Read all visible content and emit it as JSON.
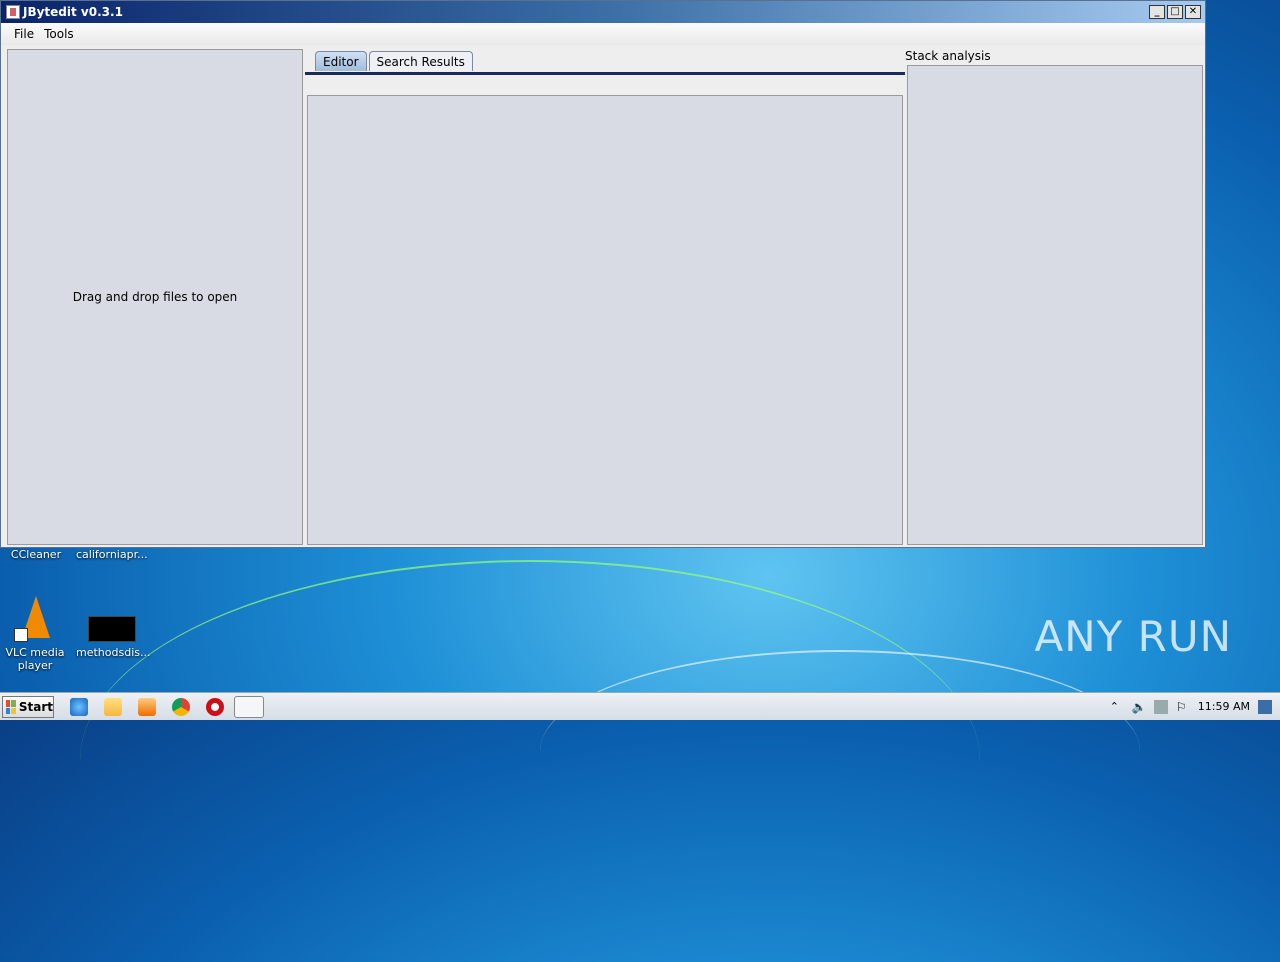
{
  "window": {
    "title": "JBytedit v0.3.1",
    "minimize": "_",
    "maximize": "□",
    "close": "✕"
  },
  "menu": [
    "File",
    "Tools"
  ],
  "left_pane": {
    "message": "Drag and drop files to open"
  },
  "tabs": [
    {
      "label": "Editor",
      "active": true
    },
    {
      "label": "Search Results",
      "active": false
    }
  ],
  "stack_panel": {
    "label": "Stack analysis"
  },
  "desktop": {
    "icons": [
      {
        "label": "CCleaner",
        "icon": "ccleaner-icon"
      },
      {
        "label": "californiapr...",
        "icon": "file-icon"
      },
      {
        "label": "VLC media player",
        "icon": "vlc-icon"
      },
      {
        "label": "methodsdis...",
        "icon": "black-file-icon"
      }
    ],
    "watermark": "ANY RUN"
  },
  "taskbar": {
    "start_label": "Start",
    "pinned": [
      "ie-icon",
      "explorer-icon",
      "media-player-icon",
      "chrome-icon",
      "opera-icon",
      "java-app-icon"
    ],
    "tray_icons": [
      "arrow-up-icon",
      "speaker-icon",
      "network-icon",
      "flag-icon"
    ],
    "clock": "11:59 AM"
  }
}
